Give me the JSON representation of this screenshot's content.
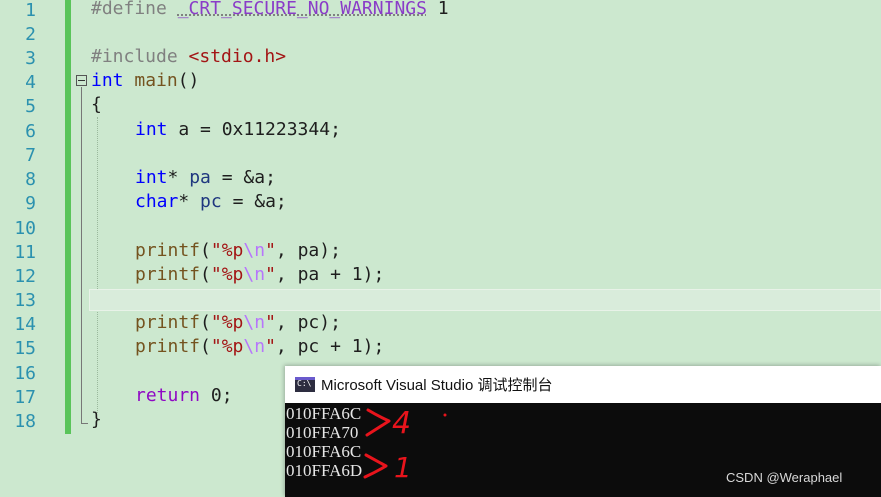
{
  "editor": {
    "line_numbers": [
      "1",
      "2",
      "3",
      "4",
      "5",
      "6",
      "7",
      "8",
      "9",
      "10",
      "11",
      "12",
      "13",
      "14",
      "15",
      "16",
      "17",
      "18"
    ],
    "code": {
      "l1_directive": "#define",
      "l1_macro": "_CRT_SECURE_NO_WARNINGS",
      "l1_value": "1",
      "l3_directive": "#include",
      "l3_header": "<stdio.h>",
      "l4_type": "int",
      "l4_name": "main",
      "l4_parens": "()",
      "l5": "{",
      "l6_type": "int",
      "l6_rest": " a = 0x11223344;",
      "l8_type": "int",
      "l8_star": "* ",
      "l8_var": "pa",
      "l8_rest": " = &a;",
      "l9_type": "char",
      "l9_star": "* ",
      "l9_var": "pc",
      "l9_rest": " = &a;",
      "printf": "printf",
      "open": "(",
      "q1": "\"%p",
      "esc": "\\n",
      "q2": "\"",
      "l11_args": ", pa);",
      "l12_args": ", pa + 1);",
      "l14_args": ", pc);",
      "l15_args": ", pc + 1);",
      "l17_kw": "return",
      "l17_rest": " 0;",
      "l18": "}"
    }
  },
  "console": {
    "title": "Microsoft Visual Studio 调试控制台",
    "icon": "console-app-icon",
    "output": [
      "010FFA6C",
      "010FFA70",
      "010FFA6C",
      "010FFA6D"
    ],
    "annotation_1": "4",
    "annotation_2": "1",
    "annotation_color": "#e8141c"
  },
  "watermark": "CSDN @Weraphael"
}
